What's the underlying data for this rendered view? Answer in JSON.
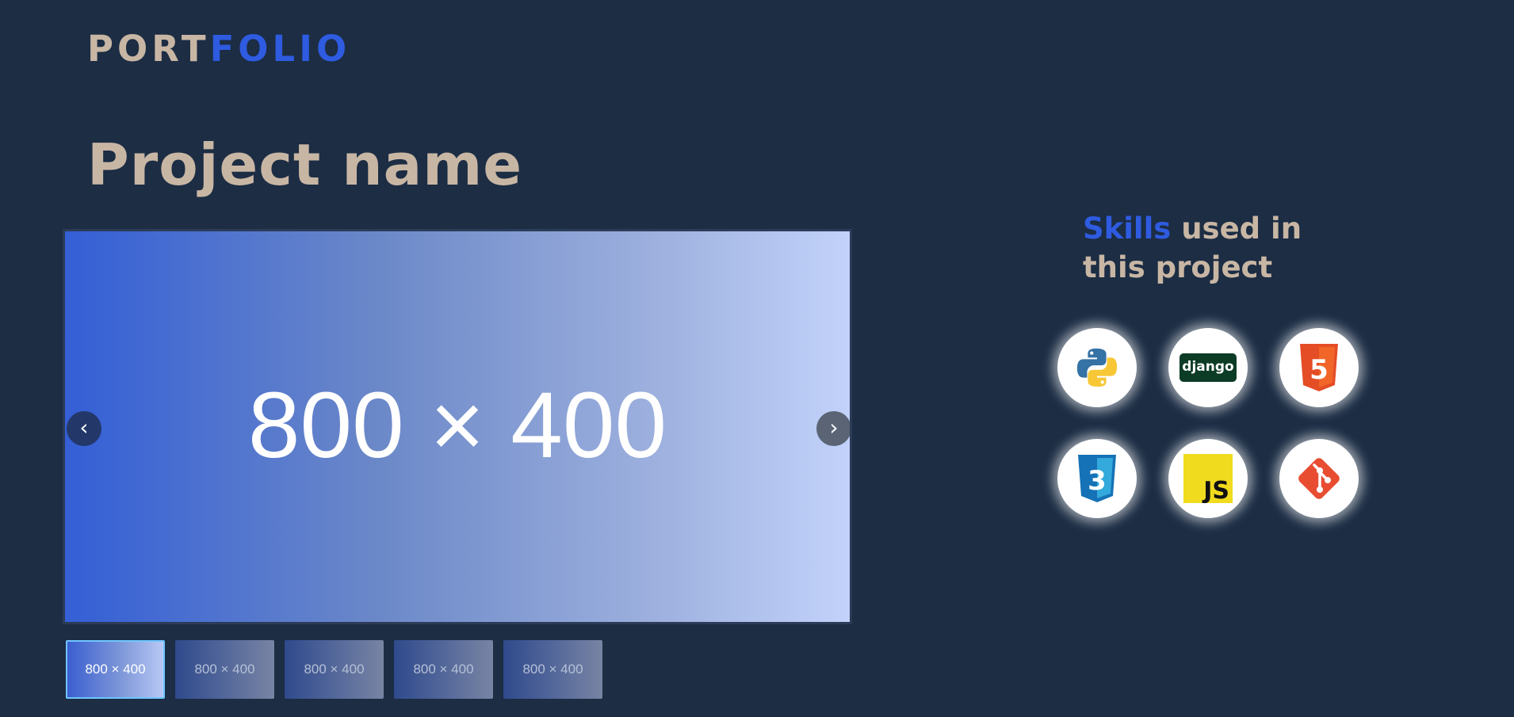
{
  "logo": {
    "part1": "PORT",
    "part2": "FOLIO"
  },
  "project": {
    "title": "Project name"
  },
  "carousel": {
    "main_slide_text": "800 × 400",
    "prev_glyph": "‹",
    "next_glyph": "›",
    "thumbnails": [
      {
        "label": "800 × 400",
        "active": true
      },
      {
        "label": "800 × 400",
        "active": false
      },
      {
        "label": "800 × 400",
        "active": false
      },
      {
        "label": "800 × 400",
        "active": false
      },
      {
        "label": "800 × 400",
        "active": false
      }
    ]
  },
  "skills": {
    "title_highlight": "Skills",
    "title_rest": " used in this project",
    "items": [
      {
        "icon": "python-icon"
      },
      {
        "icon": "django-icon",
        "text": "django"
      },
      {
        "icon": "html5-icon",
        "text": "5"
      },
      {
        "icon": "css3-icon",
        "text": "3"
      },
      {
        "icon": "javascript-icon",
        "text": "JS"
      },
      {
        "icon": "git-icon"
      }
    ]
  },
  "colors": {
    "background": "#1c2d44",
    "accent": "#2e5be0",
    "beige_text": "#c8b6a4"
  }
}
